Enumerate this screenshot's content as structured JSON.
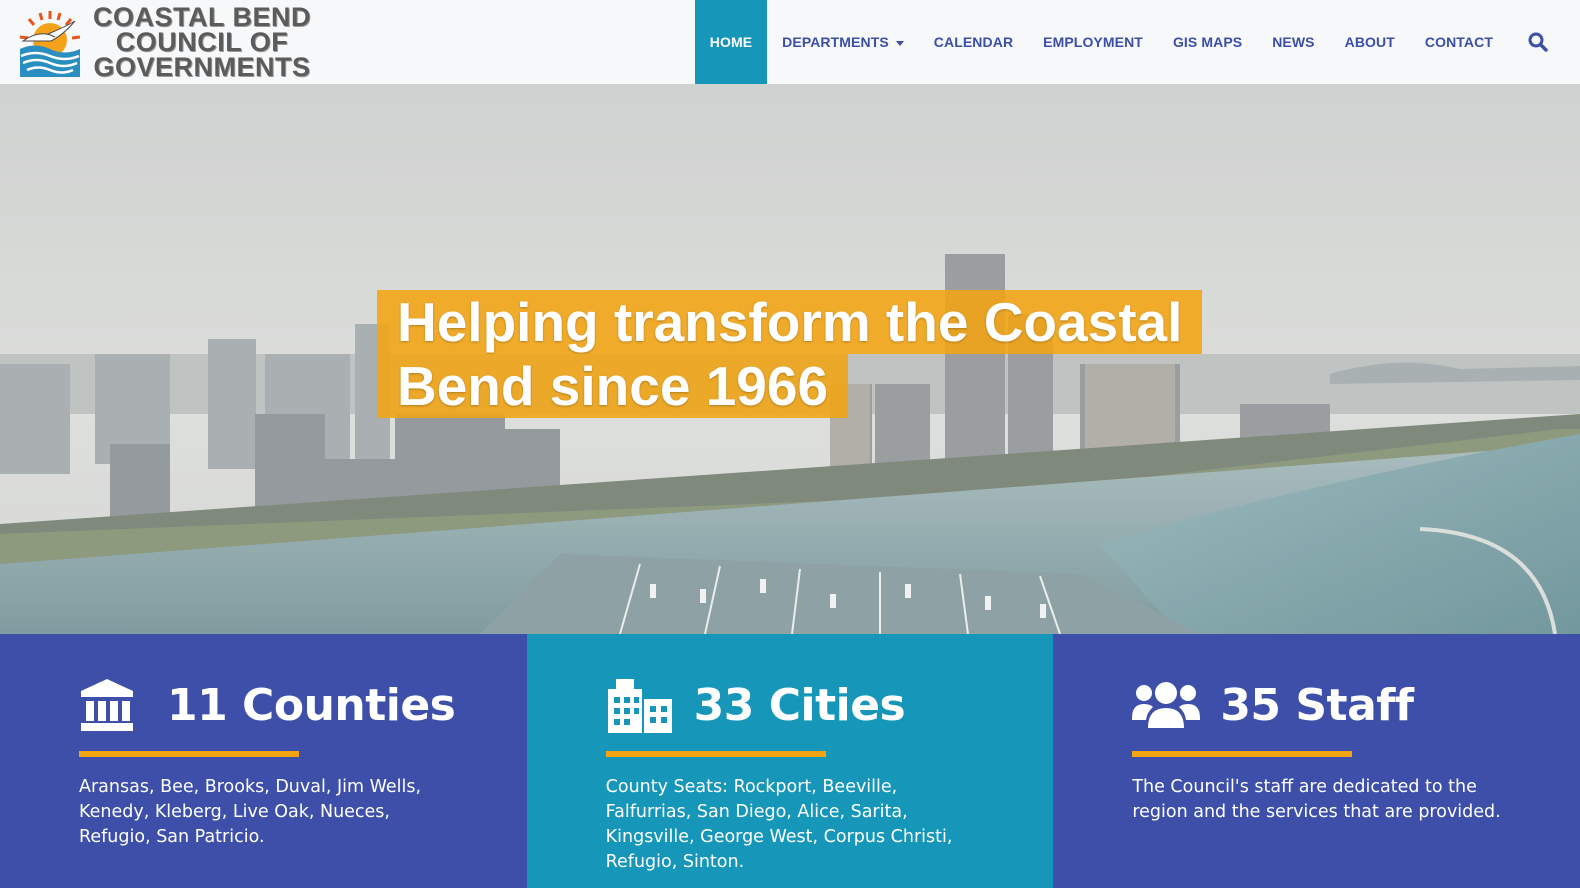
{
  "site": {
    "logo_lines": [
      "COASTAL BEND",
      "COUNCIL OF",
      "GOVERNMENTS"
    ]
  },
  "nav": {
    "items": [
      {
        "label": "HOME",
        "active": true
      },
      {
        "label": "DEPARTMENTS",
        "has_dropdown": true
      },
      {
        "label": "CALENDAR"
      },
      {
        "label": "EMPLOYMENT"
      },
      {
        "label": "GIS MAPS"
      },
      {
        "label": "NEWS"
      },
      {
        "label": "ABOUT"
      },
      {
        "label": "CONTACT"
      }
    ],
    "search_icon": "search-icon"
  },
  "hero": {
    "headline_line1": "Helping transform the Coastal",
    "headline_line2": "Bend since 1966"
  },
  "stats": [
    {
      "icon": "landmark-icon",
      "title": "11 Counties",
      "text": "Aransas, Bee, Brooks, Duval, Jim Wells, Kenedy, Kleberg, Live Oak, Nueces, Refugio, San Patricio."
    },
    {
      "icon": "city-icon",
      "title": "33 Cities",
      "text": "County Seats: Rockport, Beeville, Falfurrias, San Diego, Alice, Sarita, Kingsville, George West, Corpus Christi, Refugio, Sinton."
    },
    {
      "icon": "users-icon",
      "title": "35 Staff",
      "text": "The Council's staff are dedicated to the region and the services that are provided."
    }
  ],
  "colors": {
    "nav_text": "#3b4fa6",
    "nav_active_bg": "#1696b9",
    "panel_blue": "#3d4fa8",
    "panel_teal": "#1696b9",
    "accent_orange": "#f3a412"
  }
}
